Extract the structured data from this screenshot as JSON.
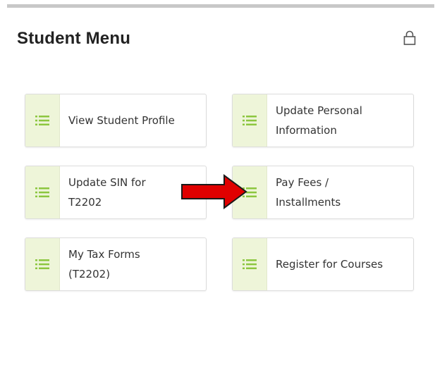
{
  "menu": {
    "title": "Student Menu"
  },
  "tiles": [
    {
      "label": "View Student Profile"
    },
    {
      "label": "Update Personal\nInformation"
    },
    {
      "label": "Update SIN for\nT2202"
    },
    {
      "label": "Pay Fees /\nInstallments"
    },
    {
      "label": "My Tax Forms\n(T2202)"
    },
    {
      "label": "Register for Courses"
    }
  ],
  "colors": {
    "accent": "#8cc63f",
    "icon_bg": "#eef5d9",
    "annotation_arrow": "#e00000"
  },
  "icons": {
    "header": "lock-icon",
    "tile": "list-icon"
  }
}
